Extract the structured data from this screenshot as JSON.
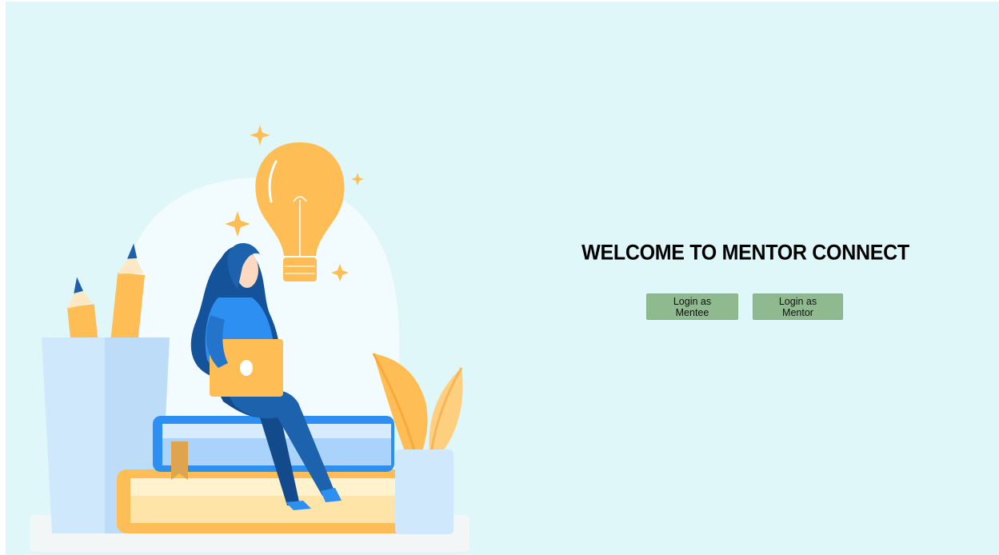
{
  "hero": {
    "title": "WELCOME TO MENTOR CONNECT"
  },
  "actions": {
    "mentee_label": "Login as Mentee",
    "mentor_label": "Login as Mentor"
  },
  "colors": {
    "page_background": "#e0f7f9",
    "button_background": "#8fb98f",
    "accent_orange": "#ffbe55",
    "accent_blue": "#2e8ff2",
    "dark_blue": "#14539a"
  },
  "illustration": {
    "icon": "woman-studying-on-books-illustration"
  }
}
